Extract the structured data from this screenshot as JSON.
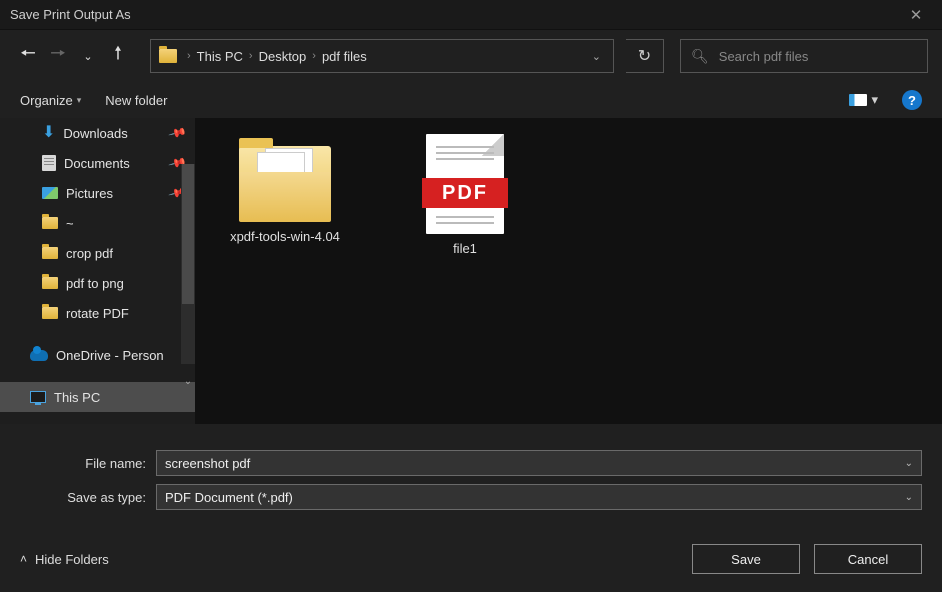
{
  "window": {
    "title": "Save Print Output As"
  },
  "breadcrumb": {
    "seg0": "This PC",
    "seg1": "Desktop",
    "seg2": "pdf files"
  },
  "search": {
    "placeholder": "Search pdf files"
  },
  "toolbar": {
    "organize": "Organize",
    "newfolder": "New folder"
  },
  "sidebar": {
    "items": [
      {
        "label": "Downloads",
        "icon": "download",
        "pinned": true
      },
      {
        "label": "Documents",
        "icon": "document",
        "pinned": true
      },
      {
        "label": "Pictures",
        "icon": "picture",
        "pinned": true
      },
      {
        "label": "~",
        "icon": "folder"
      },
      {
        "label": "crop pdf",
        "icon": "folder"
      },
      {
        "label": "pdf to png",
        "icon": "folder"
      },
      {
        "label": "rotate PDF",
        "icon": "folder"
      }
    ],
    "onedrive": "OneDrive - Person",
    "thispc": "This PC"
  },
  "files": {
    "pdf_badge": "PDF",
    "items": [
      {
        "label": "xpdf-tools-win-4.04",
        "kind": "folder"
      },
      {
        "label": "file1",
        "kind": "pdf"
      }
    ]
  },
  "form": {
    "filename_label": "File name:",
    "filename_value": "screenshot pdf",
    "savetype_label": "Save as type:",
    "savetype_value": "PDF Document (*.pdf)"
  },
  "actions": {
    "hide": "Hide Folders",
    "save": "Save",
    "cancel": "Cancel"
  }
}
